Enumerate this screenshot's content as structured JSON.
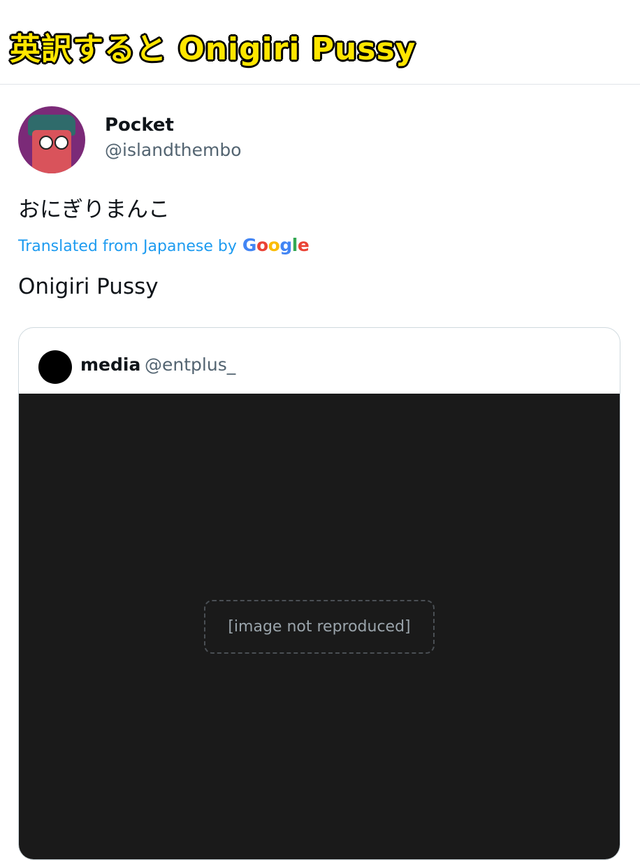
{
  "banner": {
    "text": "英訳すると Onigiri Pussy"
  },
  "tweet": {
    "author_name": "Pocket",
    "author_handle": "@islandthembo",
    "text": "おにぎりまんこ",
    "translated_label": "Translated from Japanese by",
    "translation_logo": [
      "G",
      "o",
      "o",
      "g",
      "l",
      "e"
    ],
    "translation_text": "Onigiri Pussy"
  },
  "quoted_tweet": {
    "author_name": "media",
    "author_handle": "@entplus_",
    "media_placeholder": "[image not reproduced]"
  },
  "colors": {
    "link": "#1d9bf0",
    "banner_text": "#ffe600",
    "handle": "#536471"
  }
}
